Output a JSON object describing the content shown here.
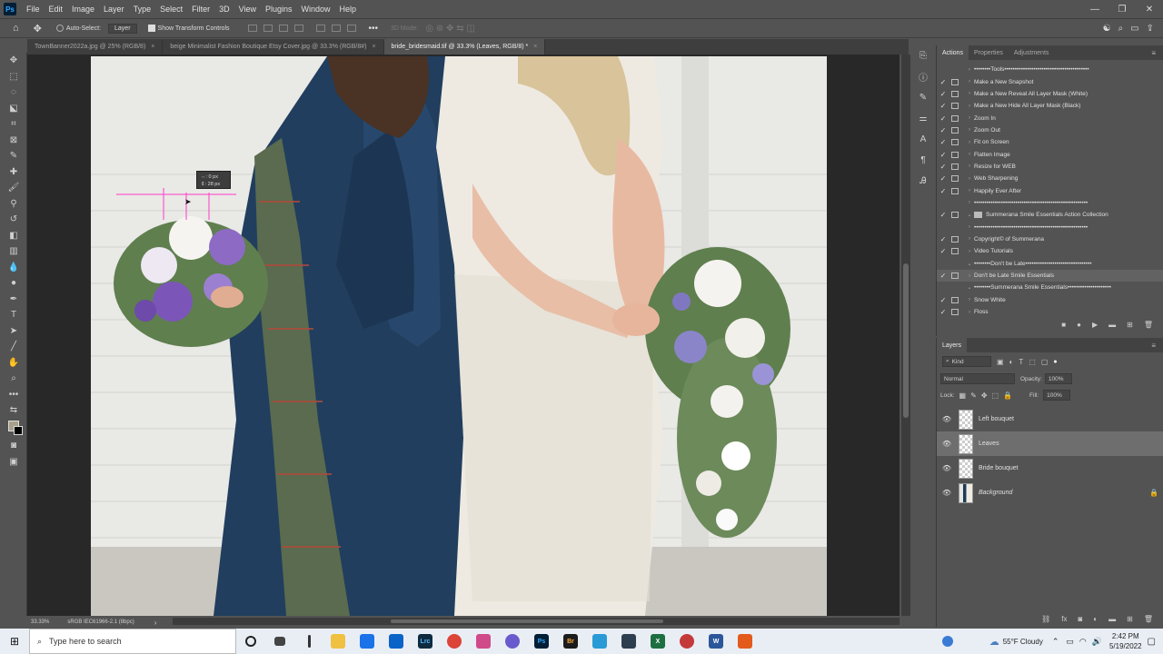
{
  "menubar": {
    "logo": "Ps",
    "items": [
      "File",
      "Edit",
      "Image",
      "Layer",
      "Type",
      "Select",
      "Filter",
      "3D",
      "View",
      "Plugins",
      "Window",
      "Help"
    ],
    "window_controls": [
      "—",
      "❐",
      "✕"
    ]
  },
  "options_bar": {
    "auto_select_label": "Auto-Select:",
    "auto_select_value": "Layer",
    "show_transform_label": "Show Transform Controls",
    "mode_3d_label": "3D Mode:"
  },
  "tabs": [
    {
      "label": "TownBanner2022a.jpg @ 25% (RGB/8)"
    },
    {
      "label": "beige Minimalist Fashion Boutique Etsy Cover.jpg @ 33.3% (RGB/8#)"
    },
    {
      "label": "bride_bridesmaid.tif @ 33.3% (Leaves, RGB/8) *"
    }
  ],
  "tooltip": {
    "line1": "⇔: 0 px",
    "line2": "⇕: 28 px"
  },
  "status": {
    "zoom": "33.33%",
    "profile": "sRGB IEC61966-2.1 (8bpc)"
  },
  "actions_panel": {
    "tabs": [
      "Actions",
      "Properties",
      "Adjustments"
    ],
    "rows": [
      {
        "label": "••••••••Tools•••••••••••••••••••••••••••••••••••••••••",
        "check": "",
        "dialog": false
      },
      {
        "label": "Make a New Snapshot",
        "check": "✓",
        "dialog": true
      },
      {
        "label": "Make a New Reveal All Layer Mask (White)",
        "check": "✓",
        "dialog": true
      },
      {
        "label": "Make a New Hide All Layer Mask (Black)",
        "check": "✓",
        "dialog": true
      },
      {
        "label": "Zoom In",
        "check": "✓",
        "dialog": true
      },
      {
        "label": "Zoom Out",
        "check": "✓",
        "dialog": true
      },
      {
        "label": "Fit on Screen",
        "check": "✓",
        "dialog": true
      },
      {
        "label": "Flatten Image",
        "check": "✓",
        "dialog": true
      },
      {
        "label": "Resize for WEB",
        "check": "✓",
        "dialog": true
      },
      {
        "label": "Web Sharpening",
        "check": "✓",
        "dialog": true
      },
      {
        "label": "Happily Ever After",
        "check": "✓",
        "dialog": true
      },
      {
        "label": "•••••••••••••••••••••••••••••••••••••••••••••••••••••••",
        "check": "",
        "dialog": false
      },
      {
        "label": "Summerana Smile Essentials Action Collection",
        "check": "✓",
        "dialog": true
      },
      {
        "label": "•••••••••••••••••••••••••••••••••••••••••••••••••••••••",
        "check": "",
        "dialog": false
      },
      {
        "label": "Copyright© of Summerana",
        "check": "✓",
        "dialog": true
      },
      {
        "label": "Video Tutorials",
        "check": "✓",
        "dialog": true
      },
      {
        "label": "••••••••Don't be Late••••••••••••••••••••••••••••••••",
        "check": "",
        "dialog": false
      },
      {
        "label": "Don't be Late Smile Essentials",
        "check": "✓",
        "dialog": true
      },
      {
        "label": "••••••••Summerana Smile Essentials•••••••••••••••••••••",
        "check": "",
        "dialog": false
      },
      {
        "label": "Snow White",
        "check": "✓",
        "dialog": true
      },
      {
        "label": "Floss",
        "check": "✓",
        "dialog": true
      }
    ]
  },
  "layers_panel": {
    "title": "Layers",
    "kind_label": "Kind",
    "blend_mode": "Normal",
    "opacity_label": "Opacity:",
    "opacity_value": "100%",
    "lock_label": "Lock:",
    "fill_label": "Fill:",
    "fill_value": "100%",
    "layers": [
      {
        "name": "Left bouquet",
        "selected": false
      },
      {
        "name": "Leaves",
        "selected": true
      },
      {
        "name": "Bride bouquet",
        "selected": false
      },
      {
        "name": "Background",
        "selected": false
      }
    ]
  },
  "taskbar": {
    "search_placeholder": "Type here to search",
    "weather": "55°F  Cloudy",
    "time": "2:42 PM",
    "date": "5/19/2022"
  }
}
